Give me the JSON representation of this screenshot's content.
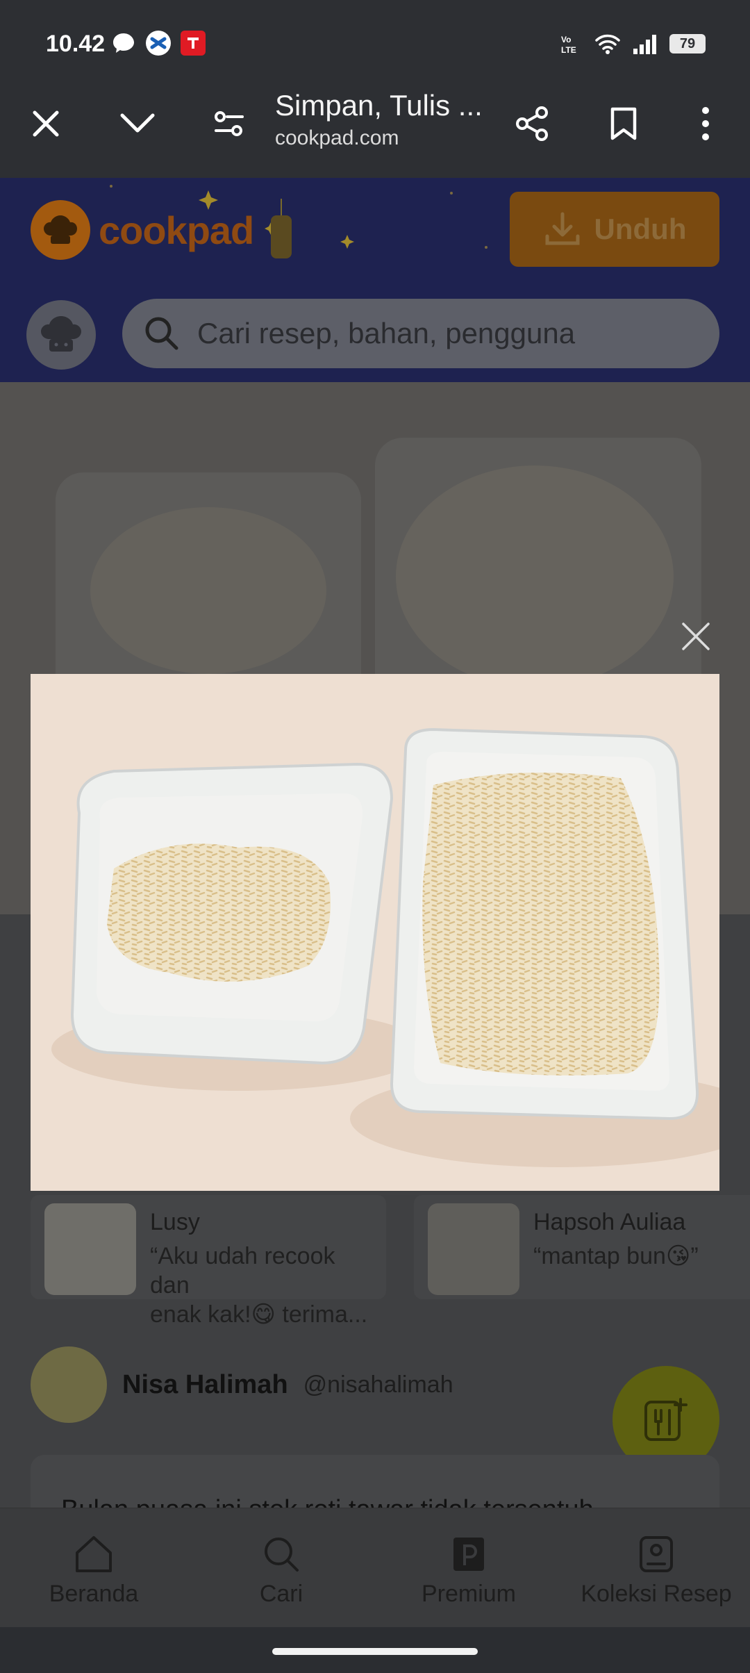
{
  "status_bar": {
    "time": "10.42",
    "battery": "79",
    "network_label": "Vo)) LTE"
  },
  "browser": {
    "page_title": "Simpan, Tulis ...",
    "domain": "cookpad.com"
  },
  "cookpad": {
    "logo_text": "cookpad",
    "download_label": "Unduh",
    "search_placeholder": "Cari resep, bahan, pengguna"
  },
  "comments": [
    {
      "name": "Lusy",
      "text_line1": "“Aku udah recook dan",
      "text_line2": "enak kak!😋 terima..."
    },
    {
      "name": "Hapsoh Auliaa",
      "text_line1": "“mantap bun😘”",
      "text_line2": ""
    }
  ],
  "author": {
    "name": "Nisa Halimah",
    "handle": "@nisahalimah"
  },
  "description_preview": "Bulan puasa ini stok roti tawar tidak tersentuh",
  "bottom_nav": [
    {
      "label": "Beranda",
      "icon": "home-icon"
    },
    {
      "label": "Cari",
      "icon": "search-icon"
    },
    {
      "label": "Premium",
      "icon": "premium-icon"
    },
    {
      "label": "Koleksi Resep",
      "icon": "collection-icon"
    }
  ],
  "colors": {
    "toolbar_bg": "#2d2f33",
    "header_bg": "#1e2250",
    "accent_orange": "#f0921e",
    "photo_bg": "#eedfd2"
  }
}
